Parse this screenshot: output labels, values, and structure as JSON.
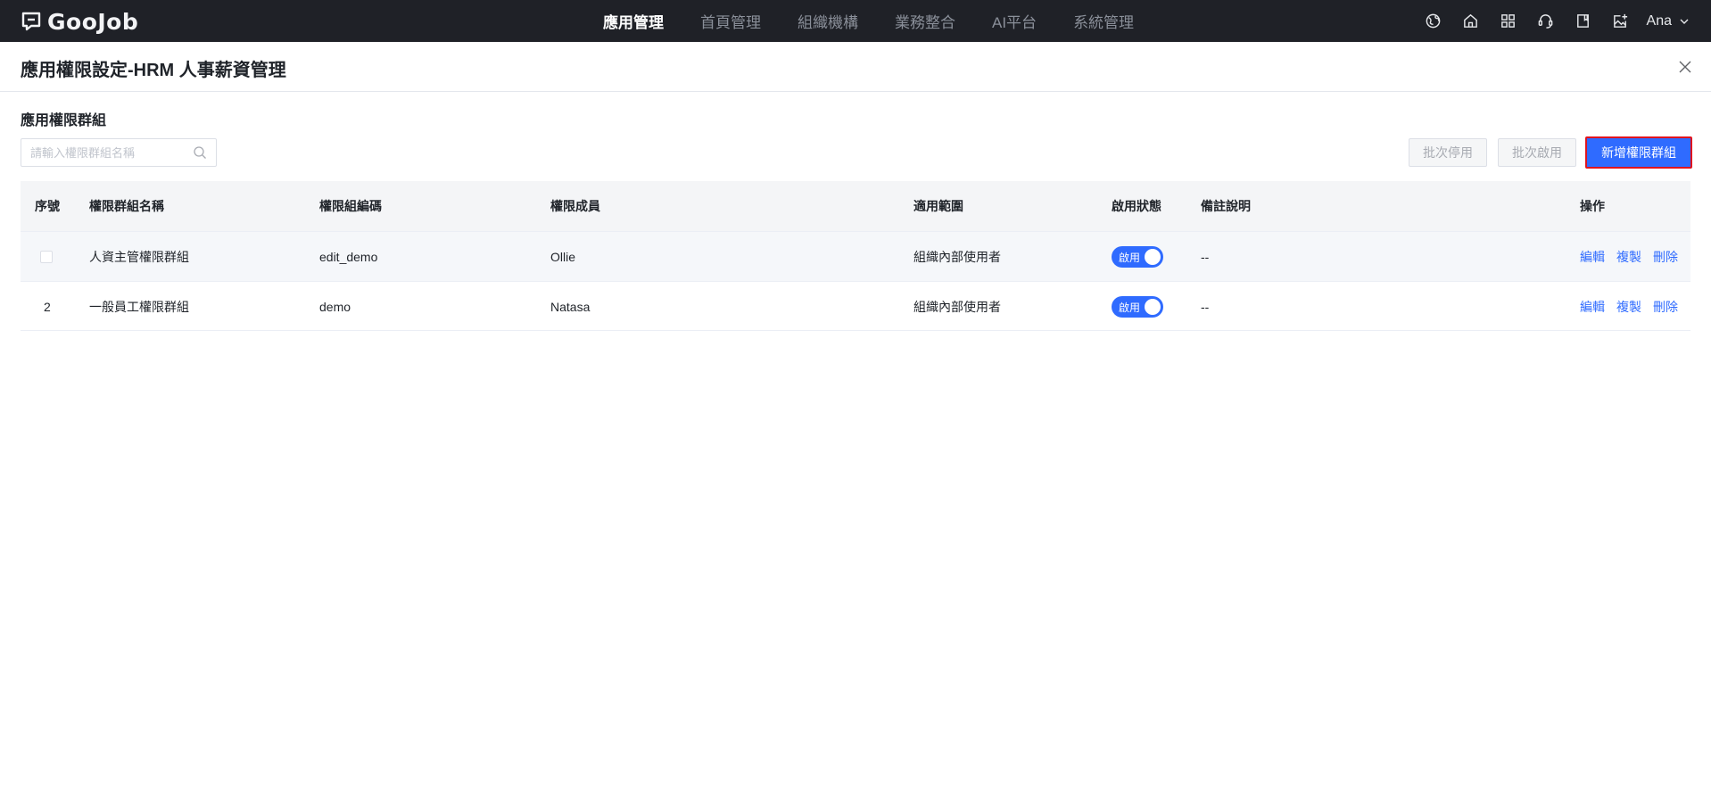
{
  "brand": {
    "name": "GooJob"
  },
  "nav": {
    "items": [
      {
        "label": "應用管理",
        "active": true
      },
      {
        "label": "首頁管理",
        "active": false
      },
      {
        "label": "組織機構",
        "active": false
      },
      {
        "label": "業務整合",
        "active": false
      },
      {
        "label": "AI平台",
        "active": false
      },
      {
        "label": "系統管理",
        "active": false
      }
    ],
    "tool_icons": [
      "language-globe-icon",
      "home-icon",
      "apps-grid-icon",
      "support-headset-icon",
      "book-icon",
      "image-add-icon"
    ],
    "user": {
      "name": "Ana"
    }
  },
  "modal": {
    "title": "應用權限設定-HRM 人事薪資管理",
    "section_title": "應用權限群組",
    "search": {
      "placeholder": "請輸入權限群組名稱",
      "value": ""
    },
    "buttons": {
      "batch_disable": "批次停用",
      "batch_enable": "批次啟用",
      "add_group": "新增權限群組"
    }
  },
  "table": {
    "headers": {
      "index": "序號",
      "name": "權限群組名稱",
      "code": "權限組編碼",
      "members": "權限成員",
      "scope": "適用範圍",
      "status": "啟用狀態",
      "remark": "備註說明",
      "actions": "操作"
    },
    "rows": [
      {
        "index": "",
        "name": "人資主管權限群組",
        "code": "edit_demo",
        "members": "Ollie",
        "scope": "組織內部使用者",
        "status": "啟用",
        "enabled": true,
        "remark": "--"
      },
      {
        "index": "2",
        "name": "一般員工權限群組",
        "code": "demo",
        "members": "Natasa",
        "scope": "組織內部使用者",
        "status": "啟用",
        "enabled": true,
        "remark": "--"
      }
    ],
    "row_actions": {
      "edit": "編輯",
      "copy": "複製",
      "delete": "刪除"
    }
  },
  "colors": {
    "topbar": "#1f2127",
    "primary": "#2f6bff",
    "highlight_border": "#e0141e",
    "header_bg": "#f4f5f7"
  }
}
